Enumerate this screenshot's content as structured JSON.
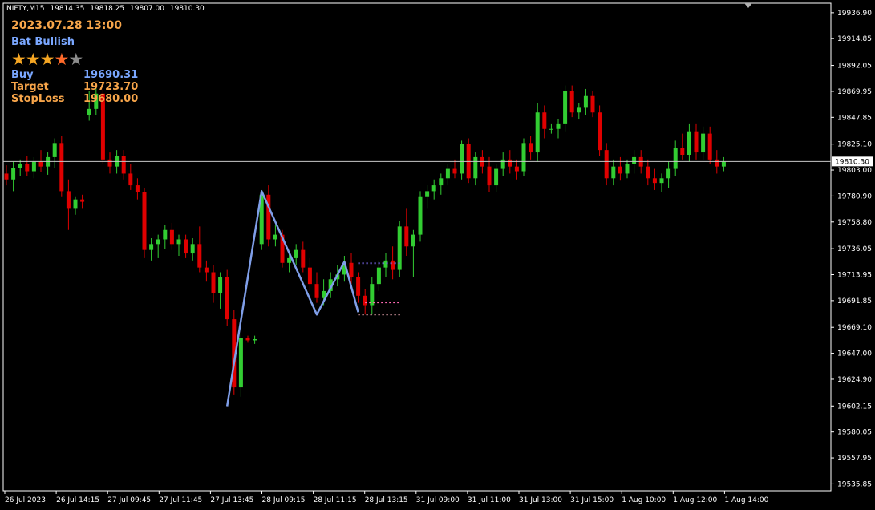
{
  "header": {
    "symbol": "NIFTY,M15",
    "open": "19814.35",
    "high": "19818.25",
    "low": "19807.00",
    "close": "19810.30"
  },
  "signal": {
    "datetime": "2023.07.28 13:00",
    "pattern": "Bat Bullish",
    "stars": 4,
    "stars_total": 5,
    "rows": [
      {
        "label": "Buy",
        "value": "19690.31",
        "color": "#7aa7ff"
      },
      {
        "label": "Target",
        "value": "19723.70",
        "color": "#f7a54a"
      },
      {
        "label": "StopLoss",
        "value": "19680.00",
        "color": "#f7a54a"
      }
    ]
  },
  "colors": {
    "background": "#000000",
    "bull": "#32cd32",
    "bear": "#e00000",
    "grid": "#ffffff",
    "pattern_line": "#7f9ee8",
    "target_level": "#7b68ee",
    "buy_level": "#ff69b4",
    "stop_level": "#ffb6c1"
  },
  "chart_data": {
    "type": "candlestick",
    "ylim": [
      19530.0,
      19945.0
    ],
    "y_ticks": [
      "19936.90",
      "19914.85",
      "19892.05",
      "19869.95",
      "19847.85",
      "19825.10",
      "19803.00",
      "19780.90",
      "19758.80",
      "19736.05",
      "19713.95",
      "19691.85",
      "19669.10",
      "19647.00",
      "19624.90",
      "19602.15",
      "19580.05",
      "19557.95",
      "19535.85"
    ],
    "x_labels": [
      "26 Jul 2023",
      "26 Jul 14:15",
      "27 Jul 09:45",
      "27 Jul 11:45",
      "27 Jul 13:45",
      "28 Jul 09:15",
      "28 Jul 11:15",
      "28 Jul 13:15",
      "31 Jul 09:00",
      "31 Jul 11:00",
      "31 Jul 13:00",
      "31 Jul 15:00",
      "1 Aug 10:00",
      "1 Aug 12:00",
      "1 Aug 14:00"
    ],
    "current_price": 19810.3,
    "candles": [
      [
        19800,
        19807,
        19790,
        19795
      ],
      [
        19795,
        19810,
        19785,
        19805
      ],
      [
        19805,
        19812,
        19798,
        19808
      ],
      [
        19808,
        19815,
        19798,
        19802
      ],
      [
        19802,
        19814,
        19796,
        19810
      ],
      [
        19810,
        19820,
        19801,
        19806
      ],
      [
        19806,
        19818,
        19799,
        19814
      ],
      [
        19814,
        19830,
        19805,
        19826
      ],
      [
        19826,
        19832,
        19780,
        19785
      ],
      [
        19785,
        19795,
        19752,
        19770
      ],
      [
        19770,
        19780,
        19765,
        19778
      ],
      [
        19778,
        19782,
        19770,
        19776
      ],
      [
        19850,
        19870,
        19845,
        19855
      ],
      [
        19855,
        19875,
        19850,
        19868
      ],
      [
        19868,
        19872,
        19808,
        19812
      ],
      [
        19812,
        19818,
        19800,
        19806
      ],
      [
        19806,
        19820,
        19800,
        19815
      ],
      [
        19815,
        19820,
        19795,
        19800
      ],
      [
        19800,
        19808,
        19786,
        19790
      ],
      [
        19790,
        19796,
        19778,
        19784
      ],
      [
        19784,
        19788,
        19728,
        19735
      ],
      [
        19735,
        19745,
        19726,
        19740
      ],
      [
        19740,
        19748,
        19728,
        19744
      ],
      [
        19744,
        19756,
        19736,
        19752
      ],
      [
        19752,
        19758,
        19735,
        19740
      ],
      [
        19740,
        19748,
        19730,
        19744
      ],
      [
        19744,
        19748,
        19728,
        19732
      ],
      [
        19732,
        19745,
        19726,
        19740
      ],
      [
        19740,
        19755,
        19716,
        19720
      ],
      [
        19720,
        19726,
        19708,
        19716
      ],
      [
        19716,
        19722,
        19690,
        19698
      ],
      [
        19698,
        19716,
        19685,
        19712
      ],
      [
        19712,
        19718,
        19670,
        19676
      ],
      [
        19676,
        19684,
        19612,
        19618
      ],
      [
        19618,
        19664,
        19610,
        19660
      ],
      [
        19660,
        19662,
        19656,
        19658
      ],
      [
        19658,
        19662,
        19655,
        19659
      ],
      [
        19740,
        19786,
        19735,
        19782
      ],
      [
        19782,
        19790,
        19738,
        19744
      ],
      [
        19744,
        19756,
        19738,
        19748
      ],
      [
        19748,
        19752,
        19720,
        19724
      ],
      [
        19724,
        19734,
        19716,
        19728
      ],
      [
        19728,
        19740,
        19722,
        19735
      ],
      [
        19735,
        19742,
        19716,
        19720
      ],
      [
        19720,
        19728,
        19700,
        19706
      ],
      [
        19706,
        19716,
        19690,
        19694
      ],
      [
        19694,
        19710,
        19688,
        19700
      ],
      [
        19700,
        19716,
        19694,
        19710
      ],
      [
        19710,
        19722,
        19704,
        19714
      ],
      [
        19714,
        19730,
        19708,
        19724
      ],
      [
        19724,
        19732,
        19706,
        19712
      ],
      [
        19712,
        19716,
        19690,
        19696
      ],
      [
        19696,
        19702,
        19680,
        19688
      ],
      [
        19688,
        19712,
        19680,
        19706
      ],
      [
        19706,
        19726,
        19700,
        19720
      ],
      [
        19720,
        19732,
        19712,
        19726
      ],
      [
        19726,
        19738,
        19710,
        19718
      ],
      [
        19718,
        19760,
        19712,
        19755
      ],
      [
        19755,
        19770,
        19730,
        19738
      ],
      [
        19738,
        19752,
        19712,
        19748
      ],
      [
        19748,
        19785,
        19742,
        19780
      ],
      [
        19780,
        19790,
        19770,
        19785
      ],
      [
        19785,
        19795,
        19778,
        19790
      ],
      [
        19790,
        19800,
        19782,
        19796
      ],
      [
        19796,
        19808,
        19790,
        19804
      ],
      [
        19804,
        19812,
        19796,
        19800
      ],
      [
        19800,
        19828,
        19795,
        19825
      ],
      [
        19825,
        19830,
        19792,
        19796
      ],
      [
        19796,
        19818,
        19790,
        19814
      ],
      [
        19814,
        19820,
        19800,
        19806
      ],
      [
        19806,
        19814,
        19784,
        19790
      ],
      [
        19790,
        19808,
        19784,
        19804
      ],
      [
        19804,
        19818,
        19798,
        19812
      ],
      [
        19812,
        19820,
        19800,
        19806
      ],
      [
        19806,
        19812,
        19795,
        19802
      ],
      [
        19802,
        19830,
        19798,
        19826
      ],
      [
        19826,
        19832,
        19812,
        19818
      ],
      [
        19818,
        19860,
        19810,
        19852
      ],
      [
        19852,
        19858,
        19830,
        19838
      ],
      [
        19838,
        19842,
        19834,
        19838
      ],
      [
        19838,
        19846,
        19830,
        19842
      ],
      [
        19842,
        19875,
        19836,
        19870
      ],
      [
        19870,
        19875,
        19848,
        19852
      ],
      [
        19852,
        19860,
        19846,
        19856
      ],
      [
        19856,
        19872,
        19850,
        19866
      ],
      [
        19866,
        19870,
        19848,
        19852
      ],
      [
        19852,
        19858,
        19815,
        19820
      ],
      [
        19820,
        19826,
        19790,
        19796
      ],
      [
        19796,
        19812,
        19790,
        19806
      ],
      [
        19806,
        19814,
        19794,
        19800
      ],
      [
        19800,
        19812,
        19796,
        19808
      ],
      [
        19808,
        19820,
        19800,
        19814
      ],
      [
        19814,
        19820,
        19800,
        19806
      ],
      [
        19806,
        19812,
        19790,
        19796
      ],
      [
        19796,
        19804,
        19786,
        19792
      ],
      [
        19792,
        19800,
        19784,
        19796
      ],
      [
        19796,
        19810,
        19788,
        19804
      ],
      [
        19804,
        19828,
        19798,
        19822
      ],
      [
        19822,
        19834,
        19812,
        19816
      ],
      [
        19816,
        19842,
        19810,
        19836
      ],
      [
        19836,
        19842,
        19812,
        19818
      ],
      [
        19818,
        19840,
        19812,
        19834
      ],
      [
        19834,
        19840,
        19808,
        19812
      ],
      [
        19812,
        19820,
        19800,
        19806
      ],
      [
        19806,
        19814,
        19802,
        19810
      ]
    ],
    "harmonic_pattern": {
      "name": "Bat Bullish",
      "points": [
        [
          32,
          19602
        ],
        [
          37,
          19785
        ],
        [
          45,
          19680
        ],
        [
          49,
          19725
        ],
        [
          51,
          19682
        ]
      ]
    },
    "levels": [
      {
        "name": "Target",
        "price": 19723.7,
        "from_candle": 51,
        "to_candle": 57
      },
      {
        "name": "Buy",
        "price": 19690.31,
        "from_candle": 52,
        "to_candle": 57
      },
      {
        "name": "StopLoss",
        "price": 19680.0,
        "from_candle": 51,
        "to_candle": 57
      }
    ]
  }
}
